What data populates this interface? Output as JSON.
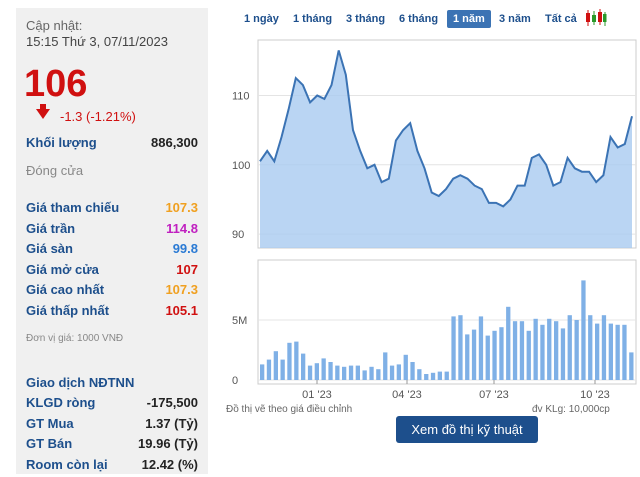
{
  "stock": {
    "updated_label": "Cập nhật:",
    "updated_time": "15:15 Thứ 3, 07/11/2023",
    "price": "106",
    "change": "-1.3 (-1.21%)",
    "volume_label": "Khối lượng",
    "volume_value": "886,300",
    "status": "Đóng cửa",
    "unit_note": "Đơn vị giá: 1000 VNĐ"
  },
  "price_rows": [
    {
      "label": "Giá tham chiếu",
      "value": "107.3",
      "color": "#f0a020"
    },
    {
      "label": "Giá trần",
      "value": "114.8",
      "color": "#c020c0"
    },
    {
      "label": "Giá sàn",
      "value": "99.8",
      "color": "#2a7ad4"
    },
    {
      "label": "Giá mở cửa",
      "value": "107",
      "color": "#d01010"
    },
    {
      "label": "Giá cao nhất",
      "value": "107.3",
      "color": "#f0a020"
    },
    {
      "label": "Giá thấp nhất",
      "value": "105.1",
      "color": "#d01010"
    }
  ],
  "foreign": {
    "title": "Giao dịch NĐTNN",
    "rows": [
      {
        "label": "KLGD ròng",
        "value": "-175,500"
      },
      {
        "label": "GT Mua",
        "value": "1.37 (Tỷ)"
      },
      {
        "label": "GT Bán",
        "value": "19.96 (Tỷ)"
      },
      {
        "label": "Room còn lại",
        "value": "12.42 (%)"
      }
    ]
  },
  "tabs": [
    "1 ngày",
    "1 tháng",
    "3 tháng",
    "6 tháng",
    "1 năm",
    "3 năm",
    "Tất cả"
  ],
  "active_tab": "1 năm",
  "notes": {
    "adjusted": "Đồ thị vẽ theo giá điều chỉnh",
    "volume_unit": "đv KLg: 10,000cp"
  },
  "tech_button": "Xem đồ thị kỹ thuật",
  "chart_data": [
    {
      "type": "area",
      "ylim": [
        88,
        118
      ],
      "yticks": [
        "90",
        "100",
        "110"
      ],
      "values": [
        100.5,
        102,
        100.5,
        104,
        108,
        112.5,
        111.5,
        109,
        110,
        109.5,
        111.5,
        116.5,
        113,
        105,
        102,
        99.5,
        100,
        97.5,
        98,
        103.5,
        105,
        106,
        102,
        99.5,
        96,
        95.5,
        96.5,
        98,
        98.5,
        98,
        97,
        96.5,
        94.5,
        94.5,
        94,
        95,
        97,
        97,
        101,
        101.5,
        100,
        97,
        97.5,
        101,
        99.5,
        99,
        99,
        97.5,
        98.5,
        104,
        102.5,
        103,
        107
      ]
    },
    {
      "type": "bar",
      "ytick_labels": [
        "0",
        "5M"
      ],
      "ylim": [
        0,
        10
      ],
      "xticks": [
        "01 '23",
        "04 '23",
        "07 '23",
        "10 '23"
      ],
      "values": [
        1.3,
        1.7,
        2.4,
        1.7,
        3.1,
        3.2,
        2.2,
        1.2,
        1.4,
        1.8,
        1.5,
        1.2,
        1.1,
        1.2,
        1.2,
        0.8,
        1.1,
        0.9,
        2.3,
        1.2,
        1.3,
        2.1,
        1.5,
        0.9,
        0.5,
        0.6,
        0.7,
        0.7,
        5.3,
        5.4,
        3.8,
        4.2,
        5.3,
        3.7,
        4.1,
        4.4,
        6.1,
        4.9,
        4.9,
        4.1,
        5.1,
        4.6,
        5.1,
        4.9,
        4.3,
        5.4,
        5.0,
        8.3,
        5.4,
        4.7,
        5.4,
        4.7,
        4.6,
        4.6,
        2.3
      ]
    }
  ]
}
